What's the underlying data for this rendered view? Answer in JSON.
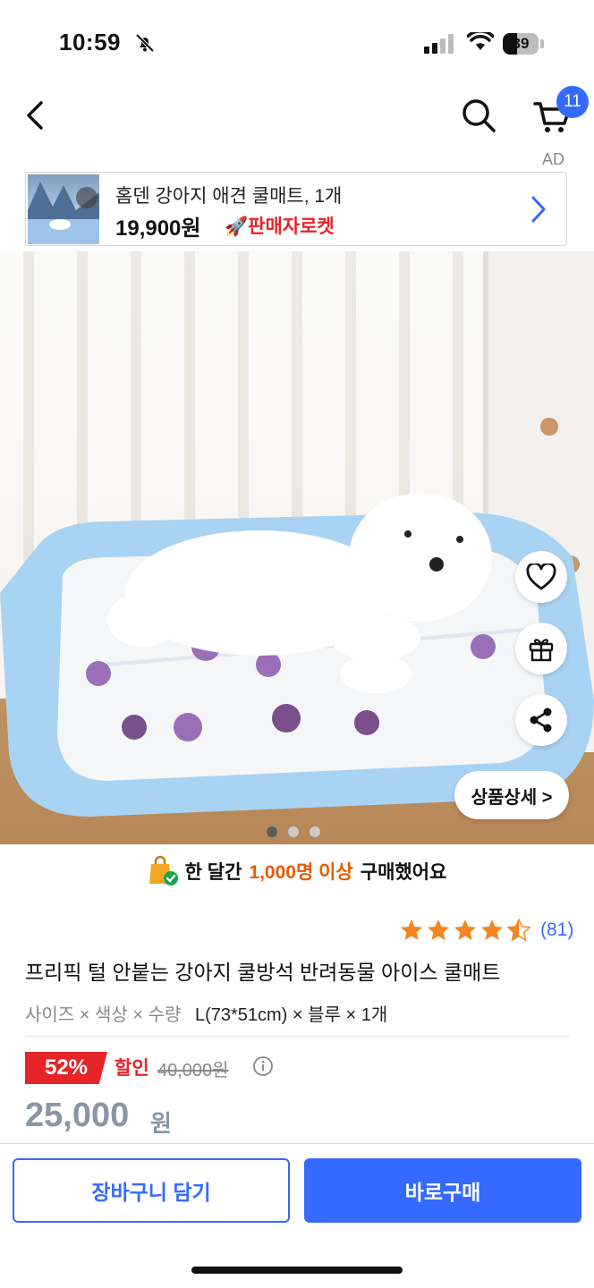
{
  "status_bar": {
    "time": "10:59",
    "battery": "39"
  },
  "header": {
    "cart_count": "11",
    "ad_label": "AD"
  },
  "ad_banner": {
    "title": "홈덴 강아지 애견 쿨매트, 1개",
    "price": "19,900원",
    "rocket_label": "🚀판매자로켓"
  },
  "hero": {
    "detail_button": "상품상세 >",
    "page_indicator": {
      "count": 3,
      "active": 1
    }
  },
  "purchase_info": {
    "prefix": "한 달간",
    "highlight": "1,000명 이상",
    "suffix": "구매했어요"
  },
  "rating": {
    "stars": 4.5,
    "review_count": "(81)"
  },
  "product": {
    "title": "프리픽 털 안붙는 강아지 쿨방석 반려동물 아이스 쿨매트",
    "options_label": "사이즈 × 색상 × 수량",
    "options_value": "L(73*51cm) × 블루 × 1개"
  },
  "pricing": {
    "discount_rate": "52%",
    "discount_label": "할인",
    "original_price": "40,000원",
    "sale_price": "25,000",
    "currency": "원"
  },
  "actions": {
    "add_to_cart": "장바구니 담기",
    "buy_now": "바로구매"
  },
  "colors": {
    "accent": "#346aff",
    "discount_red": "#e52528",
    "highlight_orange": "#e65c00"
  }
}
